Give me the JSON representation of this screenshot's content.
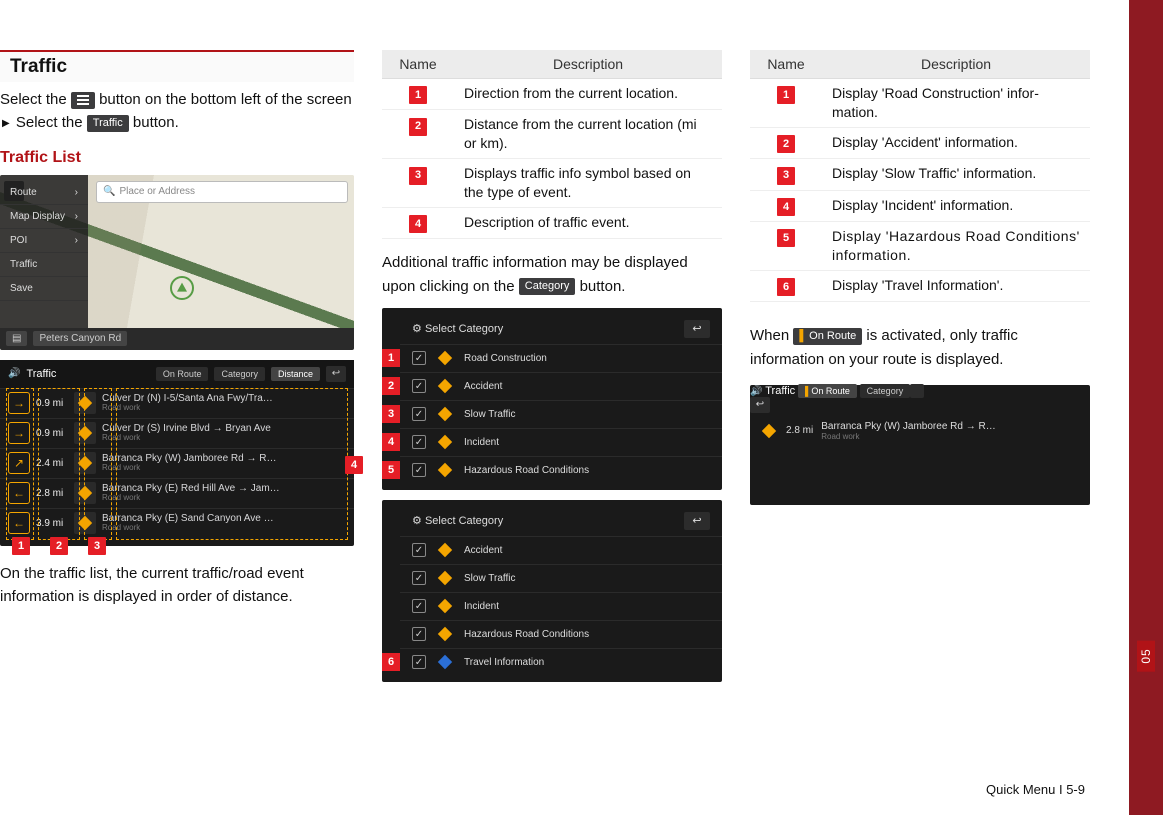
{
  "section": {
    "heading": "Traffic",
    "intro_1a": "Select the ",
    "intro_1b": " button on the bottom left of the screen ",
    "intro_1c": " Select the ",
    "intro_1d": " button.",
    "traffic_btn_label": "Traffic",
    "subhead": "Traffic List"
  },
  "map": {
    "search_placeholder": "Place or Address",
    "left_items": [
      "Route",
      "Map Display",
      "POI",
      "Traffic",
      "Save"
    ],
    "bottom_label": "Peters Canyon Rd",
    "compass": "N"
  },
  "traffic_list": {
    "header_title": "Traffic",
    "header_tabs": {
      "on_route": "On Route",
      "category": "Category",
      "distance": "Distance"
    },
    "rows": [
      {
        "dir": "→",
        "dist": "0.9 mi",
        "title": "Culver Dr (N) I-5/Santa Ana Fwy/Tra…",
        "sub": "Road work"
      },
      {
        "dir": "→",
        "dist": "0.9 mi",
        "title": "Culver Dr (S) Irvine Blvd → Bryan Ave",
        "sub": "Road work"
      },
      {
        "dir": "↗",
        "dist": "2.4 mi",
        "title": "Barranca Pky (W) Jamboree Rd → R…",
        "sub": "Road work"
      },
      {
        "dir": "←",
        "dist": "2.8 mi",
        "title": "Barranca Pky (E) Red Hill Ave → Jam…",
        "sub": "Road work"
      },
      {
        "dir": "←",
        "dist": "3.9 mi",
        "title": "Barranca Pky (E) Sand Canyon Ave …",
        "sub": "Road work"
      }
    ],
    "caption": "On the traffic list, the current traffic/road event information is displayed in order of distance."
  },
  "table1": {
    "name_hdr": "Name",
    "desc_hdr": "Description",
    "rows": [
      "Direction from the current location.",
      "Distance from the current loca­tion (mi or km).",
      "Displays traffic info symbol based on the type of event.",
      "Description of traffic event."
    ]
  },
  "mid_para_a": "Additional traffic information may be dis­played upon clicking on the ",
  "mid_para_b": " button.",
  "category_btn_label": "Category",
  "category_panel": {
    "title": "Select Category",
    "items1": [
      "Road Construction",
      "Accident",
      "Slow Traffic",
      "Incident",
      "Hazardous Road Conditions"
    ],
    "items2": [
      "Accident",
      "Slow Traffic",
      "Incident",
      "Hazardous Road Conditions",
      "Travel Information"
    ]
  },
  "table2": {
    "name_hdr": "Name",
    "desc_hdr": "Description",
    "rows": [
      "Display 'Road Construction' infor­mation.",
      "Display 'Accident' information.",
      "Display 'Slow Traffic' information.",
      "Display 'Incident' information.",
      "Display 'Hazardous Road Conditions' information.",
      "Display 'Travel Information'."
    ]
  },
  "right_para_a": "When ",
  "right_para_b": " is activated, only traffic information on your route is displayed.",
  "on_route_btn_label": "On Route",
  "onroute_panel": {
    "title": "Traffic",
    "tabs": {
      "on_route": "On Route",
      "category": "Category"
    },
    "row": {
      "dist": "2.8 mi",
      "title": "Barranca Pky (W) Jamboree Rd → R…",
      "sub": "Road work"
    }
  },
  "footer": "Quick Menu I 5-9",
  "chapter_tab": "05"
}
